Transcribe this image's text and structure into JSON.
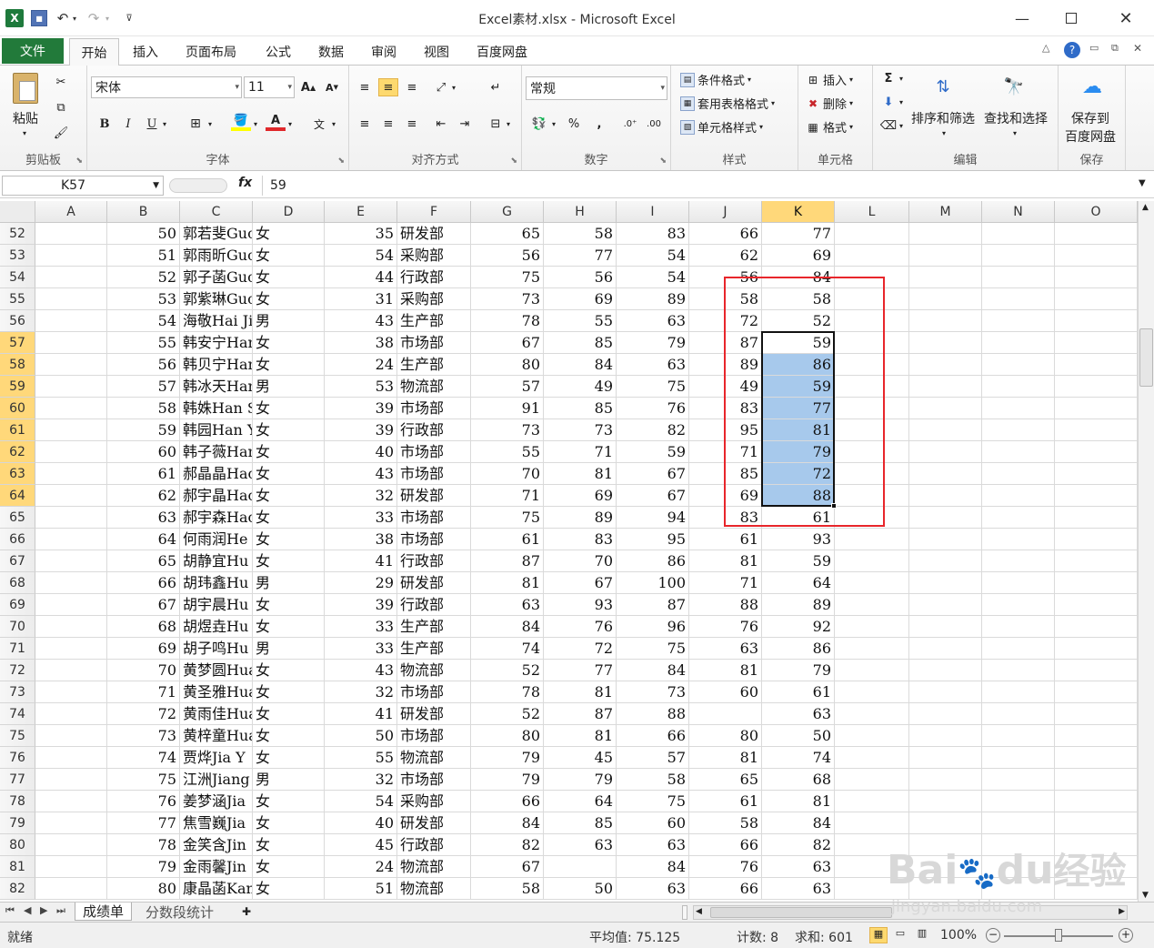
{
  "app": {
    "title": "Excel素材.xlsx - Microsoft Excel"
  },
  "titlebar": {
    "save_icon": "save-icon",
    "undo_icon": "undo-icon",
    "redo_icon": "redo-icon"
  },
  "tabs": {
    "file": "文件",
    "home": "开始",
    "insert": "插入",
    "page_layout": "页面布局",
    "formulas": "公式",
    "data": "数据",
    "review": "审阅",
    "view": "视图",
    "baidu": "百度网盘"
  },
  "ribbon": {
    "clipboard": {
      "paste": "粘贴",
      "label": "剪贴板"
    },
    "font": {
      "name": "宋体",
      "size": "11",
      "label": "字体",
      "bold": "B",
      "italic": "I",
      "underline": "U"
    },
    "alignment": {
      "label": "对齐方式"
    },
    "number": {
      "format": "常规",
      "label": "数字",
      "percent": "%",
      "comma": ","
    },
    "styles": {
      "conditional": "条件格式",
      "table": "套用表格格式",
      "cell_styles": "单元格样式",
      "label": "样式"
    },
    "cells": {
      "insert": "插入",
      "delete": "删除",
      "format": "格式",
      "label": "单元格"
    },
    "editing": {
      "sort": "排序和筛选",
      "find": "查找和选择",
      "label": "编辑"
    },
    "save": {
      "button_line1": "保存到",
      "button_line2": "百度网盘",
      "label": "保存"
    }
  },
  "formula_bar": {
    "name_box": "K57",
    "fx": "fx",
    "formula": "59"
  },
  "columns": [
    "A",
    "B",
    "C",
    "D",
    "E",
    "F",
    "G",
    "H",
    "I",
    "J",
    "K",
    "L",
    "M",
    "N",
    "O"
  ],
  "selected_column": "K",
  "rows": [
    {
      "r": "52",
      "b": "50",
      "c": "郭若斐Guo",
      "d": "女",
      "e": "35",
      "f": "研发部",
      "g": "65",
      "h": "58",
      "i": "83",
      "j": "66",
      "k": "77"
    },
    {
      "r": "53",
      "b": "51",
      "c": "郭雨昕Guo",
      "d": "女",
      "e": "54",
      "f": "采购部",
      "g": "56",
      "h": "77",
      "i": "54",
      "j": "62",
      "k": "69"
    },
    {
      "r": "54",
      "b": "52",
      "c": "郭子菡Guo",
      "d": "女",
      "e": "44",
      "f": "行政部",
      "g": "75",
      "h": "56",
      "i": "54",
      "j": "56",
      "k": "84"
    },
    {
      "r": "55",
      "b": "53",
      "c": "郭紫琳Guo",
      "d": "女",
      "e": "31",
      "f": "采购部",
      "g": "73",
      "h": "69",
      "i": "89",
      "j": "58",
      "k": "58"
    },
    {
      "r": "56",
      "b": "54",
      "c": "海敬Hai Ji",
      "d": "男",
      "e": "43",
      "f": "生产部",
      "g": "78",
      "h": "55",
      "i": "63",
      "j": "72",
      "k": "52"
    },
    {
      "r": "57",
      "b": "55",
      "c": "韩安宁Han",
      "d": "女",
      "e": "38",
      "f": "市场部",
      "g": "67",
      "h": "85",
      "i": "79",
      "j": "87",
      "k": "59"
    },
    {
      "r": "58",
      "b": "56",
      "c": "韩贝宁Han",
      "d": "女",
      "e": "24",
      "f": "生产部",
      "g": "80",
      "h": "84",
      "i": "63",
      "j": "89",
      "k": "86"
    },
    {
      "r": "59",
      "b": "57",
      "c": "韩冰天Han",
      "d": "男",
      "e": "53",
      "f": "物流部",
      "g": "57",
      "h": "49",
      "i": "75",
      "j": "49",
      "k": "59"
    },
    {
      "r": "60",
      "b": "58",
      "c": "韩姝Han Sh",
      "d": "女",
      "e": "39",
      "f": "市场部",
      "g": "91",
      "h": "85",
      "i": "76",
      "j": "83",
      "k": "77"
    },
    {
      "r": "61",
      "b": "59",
      "c": "韩园Han Yu",
      "d": "女",
      "e": "39",
      "f": "行政部",
      "g": "73",
      "h": "73",
      "i": "82",
      "j": "95",
      "k": "81"
    },
    {
      "r": "62",
      "b": "60",
      "c": "韩子薇Han",
      "d": "女",
      "e": "40",
      "f": "市场部",
      "g": "55",
      "h": "71",
      "i": "59",
      "j": "71",
      "k": "79"
    },
    {
      "r": "63",
      "b": "61",
      "c": "郝晶晶Hao",
      "d": "女",
      "e": "43",
      "f": "市场部",
      "g": "70",
      "h": "81",
      "i": "67",
      "j": "85",
      "k": "72"
    },
    {
      "r": "64",
      "b": "62",
      "c": "郝宇晶Hao",
      "d": "女",
      "e": "32",
      "f": "研发部",
      "g": "71",
      "h": "69",
      "i": "67",
      "j": "69",
      "k": "88"
    },
    {
      "r": "65",
      "b": "63",
      "c": "郝宇森Hao",
      "d": "女",
      "e": "33",
      "f": "市场部",
      "g": "75",
      "h": "89",
      "i": "94",
      "j": "83",
      "k": "61"
    },
    {
      "r": "66",
      "b": "64",
      "c": "何雨润He",
      "d": "女",
      "e": "38",
      "f": "市场部",
      "g": "61",
      "h": "83",
      "i": "95",
      "j": "61",
      "k": "93"
    },
    {
      "r": "67",
      "b": "65",
      "c": "胡静宜Hu",
      "d": "女",
      "e": "41",
      "f": "行政部",
      "g": "87",
      "h": "70",
      "i": "86",
      "j": "81",
      "k": "59"
    },
    {
      "r": "68",
      "b": "66",
      "c": "胡玮鑫Hu",
      "d": "男",
      "e": "29",
      "f": "研发部",
      "g": "81",
      "h": "67",
      "i": "100",
      "j": "71",
      "k": "64"
    },
    {
      "r": "69",
      "b": "67",
      "c": "胡宇晨Hu",
      "d": "女",
      "e": "39",
      "f": "行政部",
      "g": "63",
      "h": "93",
      "i": "87",
      "j": "88",
      "k": "89"
    },
    {
      "r": "70",
      "b": "68",
      "c": "胡煜垚Hu",
      "d": "女",
      "e": "33",
      "f": "生产部",
      "g": "84",
      "h": "76",
      "i": "96",
      "j": "76",
      "k": "92"
    },
    {
      "r": "71",
      "b": "69",
      "c": "胡子鸣Hu",
      "d": "男",
      "e": "33",
      "f": "生产部",
      "g": "74",
      "h": "72",
      "i": "75",
      "j": "63",
      "k": "86"
    },
    {
      "r": "72",
      "b": "70",
      "c": "黄梦圆Hua",
      "d": "女",
      "e": "43",
      "f": "物流部",
      "g": "52",
      "h": "77",
      "i": "84",
      "j": "81",
      "k": "79"
    },
    {
      "r": "73",
      "b": "71",
      "c": "黄圣雅Hua",
      "d": "女",
      "e": "32",
      "f": "市场部",
      "g": "78",
      "h": "81",
      "i": "73",
      "j": "60",
      "k": "61"
    },
    {
      "r": "74",
      "b": "72",
      "c": "黄雨佳Hua",
      "d": "女",
      "e": "41",
      "f": "研发部",
      "g": "52",
      "h": "87",
      "i": "88",
      "j": "",
      "k": "63"
    },
    {
      "r": "75",
      "b": "73",
      "c": "黄梓童Hua",
      "d": "女",
      "e": "50",
      "f": "市场部",
      "g": "80",
      "h": "81",
      "i": "66",
      "j": "80",
      "k": "50"
    },
    {
      "r": "76",
      "b": "74",
      "c": "贾烨Jia Y",
      "d": "女",
      "e": "55",
      "f": "物流部",
      "g": "79",
      "h": "45",
      "i": "57",
      "j": "81",
      "k": "74"
    },
    {
      "r": "77",
      "b": "75",
      "c": "江洲Jiang",
      "d": "男",
      "e": "32",
      "f": "市场部",
      "g": "79",
      "h": "79",
      "i": "58",
      "j": "65",
      "k": "68"
    },
    {
      "r": "78",
      "b": "76",
      "c": "姜梦涵Jia",
      "d": "女",
      "e": "54",
      "f": "采购部",
      "g": "66",
      "h": "64",
      "i": "75",
      "j": "61",
      "k": "81"
    },
    {
      "r": "79",
      "b": "77",
      "c": "焦雪巍Jia",
      "d": "女",
      "e": "40",
      "f": "研发部",
      "g": "84",
      "h": "85",
      "i": "60",
      "j": "58",
      "k": "84"
    },
    {
      "r": "80",
      "b": "78",
      "c": "金笑含Jin",
      "d": "女",
      "e": "45",
      "f": "行政部",
      "g": "82",
      "h": "63",
      "i": "63",
      "j": "66",
      "k": "82"
    },
    {
      "r": "81",
      "b": "79",
      "c": "金雨馨Jin",
      "d": "女",
      "e": "24",
      "f": "物流部",
      "g": "67",
      "h": "",
      "i": "84",
      "j": "76",
      "k": "63"
    },
    {
      "r": "82",
      "b": "80",
      "c": "康晶菡Kan",
      "d": "女",
      "e": "51",
      "f": "物流部",
      "g": "58",
      "h": "50",
      "i": "63",
      "j": "66",
      "k": "63"
    }
  ],
  "sheets": [
    "成绩单",
    "分数段统计"
  ],
  "status": {
    "ready": "就绪",
    "average": "平均值: 75.125",
    "count": "计数: 8",
    "sum": "求和: 601",
    "zoom": "100%"
  },
  "watermark": {
    "brand": "Bai",
    "brand2": "du",
    "cn": "经验",
    "url": "jingyan.baidu.com"
  }
}
